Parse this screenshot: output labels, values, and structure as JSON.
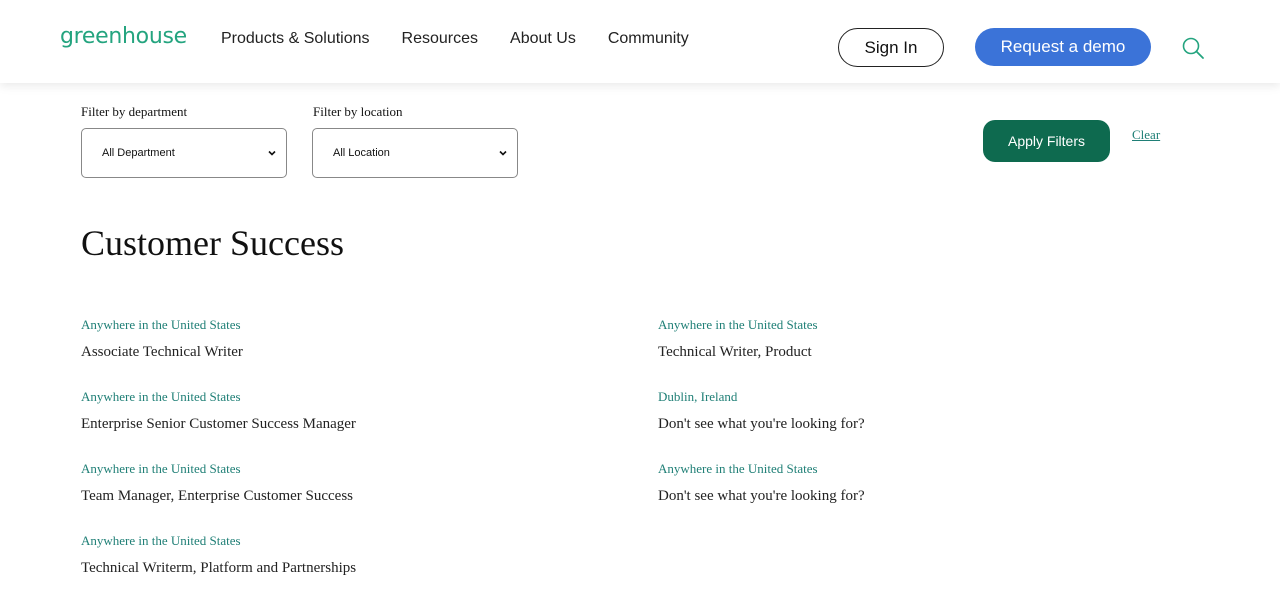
{
  "header": {
    "logo": "greenhouse",
    "nav": [
      "Products & Solutions",
      "Resources",
      "About Us",
      "Community"
    ],
    "sign_in": "Sign In",
    "request_demo": "Request a demo",
    "search_icon": "search-icon"
  },
  "filters": {
    "department_label": "Filter by department",
    "department_value": "All Department",
    "location_label": "Filter by location",
    "location_value": "All Location",
    "apply": "Apply Filters",
    "clear": "Clear"
  },
  "section": {
    "title": "Customer Success",
    "jobs_left": [
      {
        "location": "Anywhere in the United States",
        "title": "Associate Technical Writer"
      },
      {
        "location": "Anywhere in the United States",
        "title": "Enterprise Senior Customer Success Manager"
      },
      {
        "location": "Anywhere in the United States",
        "title": "Team Manager, Enterprise Customer Success"
      },
      {
        "location": "Anywhere in the United States",
        "title": "Technical Writerm, Platform and Partnerships"
      }
    ],
    "jobs_right": [
      {
        "location": "Anywhere in the United States",
        "title": "Technical Writer, Product"
      },
      {
        "location": "Dublin, Ireland",
        "title": "Don't see what you're looking for?"
      },
      {
        "location": "Anywhere in the United States",
        "title": "Don't see what you're looking for?"
      }
    ]
  },
  "colors": {
    "brand_green": "#24a47f",
    "apply_green": "#0e6a4f",
    "demo_blue": "#3b73d8",
    "link_teal": "#1f7f76"
  }
}
